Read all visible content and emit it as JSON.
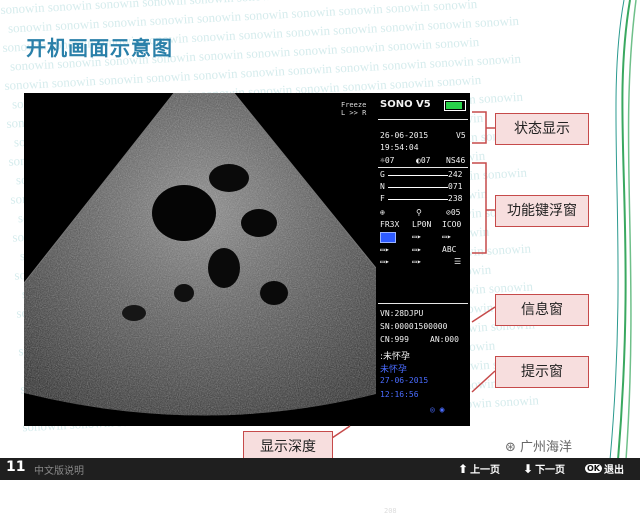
{
  "title": "开机画面示意图",
  "freeze": {
    "line1": "Freeze",
    "line2": "L >> R"
  },
  "depth": "208",
  "panel": {
    "brand": "SONO V5",
    "date": "26-06-2015",
    "version": "V5",
    "time": "19:54:04",
    "sun_val": "07",
    "contrast_val": "07",
    "ns": "NS46",
    "g_label": "G",
    "g_val": "242",
    "n_label": "N",
    "n_val": "071",
    "f_label": "F",
    "f_val": "238",
    "zoom_val": "05",
    "fr": "FR3X",
    "lpm": "LP0N",
    "ico": "ICO0",
    "abc": "ABC",
    "vn": "VN:28DJPU",
    "sn": "SN:00001500000",
    "cn": "CN:999",
    "an": "AN:000",
    "status_text": ":未怀孕",
    "hint1": "未怀孕",
    "hint2": "27-06-2015",
    "hint3": "12:16:56"
  },
  "callouts": {
    "status": "状态显示",
    "function": "功能键浮窗",
    "info": "信息窗",
    "hint": "提示窗",
    "depth": "显示深度"
  },
  "footer": {
    "page": "11",
    "logo_text": "广州海洋",
    "prev": "上一页",
    "next": "下一页",
    "ok": "OK",
    "exit": "退出",
    "bottom_left": "中文版说明"
  },
  "colors": {
    "title": "#2a80a9",
    "callout_border": "#c64a4a",
    "callout_bg": "#f7dede"
  }
}
